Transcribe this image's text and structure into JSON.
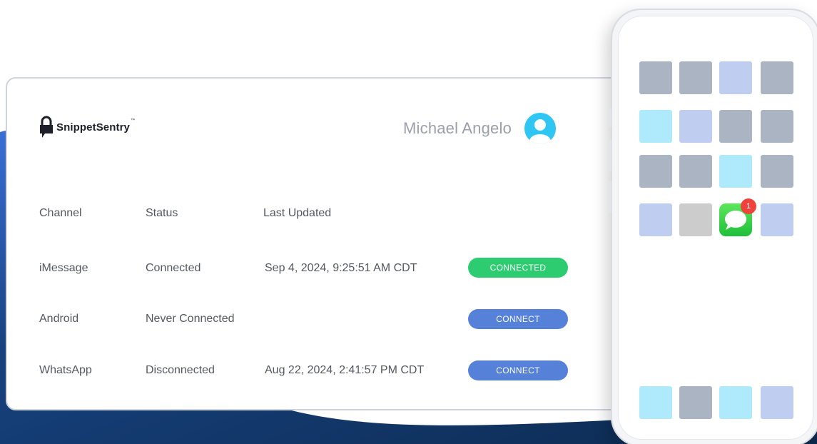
{
  "brand": {
    "name": "SnippetSentry",
    "tm": "™"
  },
  "user": {
    "name": "Michael Angelo"
  },
  "table": {
    "headers": [
      "Channel",
      "Status",
      "Last Updated"
    ],
    "rows": [
      {
        "channel": "iMessage",
        "status": "Connected",
        "updated": "Sep 4, 2024, 9:25:51 AM CDT",
        "action": "CONNECTED"
      },
      {
        "channel": "Android",
        "status": "Never Connected",
        "updated": "",
        "action": "CONNECT"
      },
      {
        "channel": "WhatsApp",
        "status": "Disconnected",
        "updated": "Aug 22, 2024, 2:41:57 PM CDT",
        "action": "CONNECT"
      }
    ]
  },
  "phone": {
    "messages_badge": "1"
  },
  "colors": {
    "connected": "#2ecc71",
    "connect": "#5681d9",
    "brand_dark": "#1d1f2a",
    "accent_avatar": "#2fc6f4",
    "background_navy": "#0e2f58"
  }
}
